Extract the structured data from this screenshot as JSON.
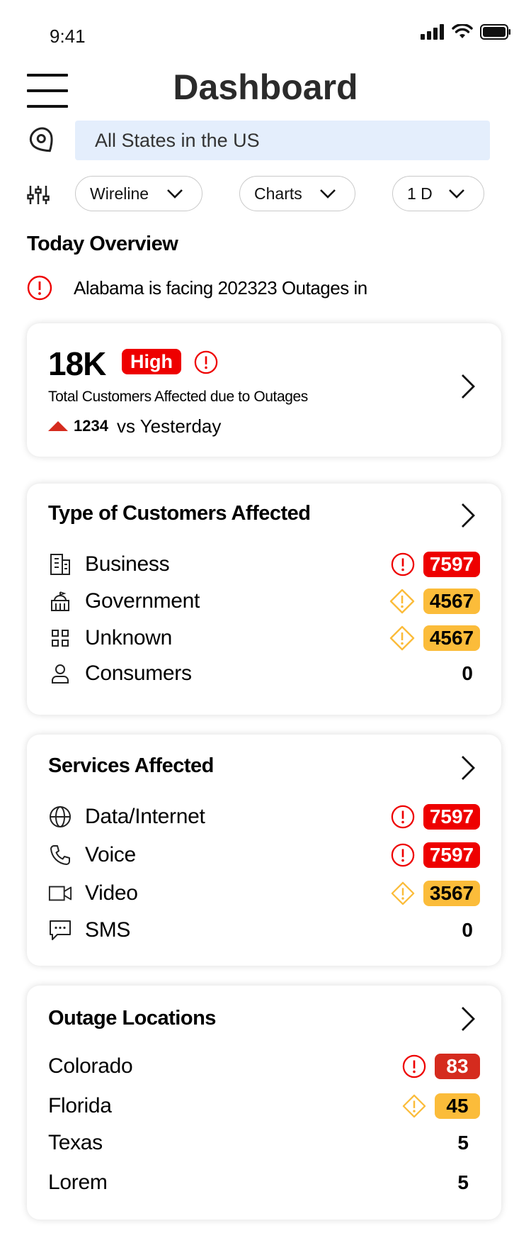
{
  "status_bar": {
    "time": "9:41"
  },
  "header": {
    "title": "Dashboard"
  },
  "location": {
    "value": "All States in the US"
  },
  "filters": {
    "network": "Wireline",
    "view": "Charts",
    "period": "1 D"
  },
  "overview": {
    "section_title": "Today Overview",
    "alert_text": "Alabama is facing 202323 Outages in",
    "total": "18K",
    "severity": "High",
    "description": "Total Customers Affected due to Outages",
    "delta": "1234",
    "delta_label": "vs Yesterday"
  },
  "customers": {
    "title": "Type of Customers Affected",
    "rows": [
      {
        "label": "Business",
        "value": "7597",
        "severity": "critical",
        "icon": "building-icon"
      },
      {
        "label": "Government",
        "value": "4567",
        "severity": "warning",
        "icon": "government-icon"
      },
      {
        "label": "Unknown",
        "value": "4567",
        "severity": "warning",
        "icon": "grid-icon"
      },
      {
        "label": "Consumers",
        "value": "0",
        "severity": "none",
        "icon": "person-icon"
      }
    ]
  },
  "services": {
    "title": "Services Affected",
    "rows": [
      {
        "label": "Data/Internet",
        "value": "7597",
        "severity": "critical",
        "icon": "globe-icon"
      },
      {
        "label": "Voice",
        "value": "7597",
        "severity": "critical",
        "icon": "phone-icon"
      },
      {
        "label": "Video",
        "value": "3567",
        "severity": "warning",
        "icon": "video-icon"
      },
      {
        "label": "SMS",
        "value": "0",
        "severity": "none",
        "icon": "message-icon"
      }
    ]
  },
  "locations": {
    "title": "Outage Locations",
    "rows": [
      {
        "label": "Colorado",
        "value": "83",
        "severity": "critical"
      },
      {
        "label": "Florida",
        "value": "45",
        "severity": "warning"
      },
      {
        "label": "Texas",
        "value": "5",
        "severity": "none"
      },
      {
        "label": "Lorem",
        "value": "5",
        "severity": "none"
      }
    ]
  },
  "colors": {
    "critical": "#ee0000",
    "critical_alt": "#d52b1e",
    "warning": "#fbbc3a",
    "input_bg": "#e4eefc"
  }
}
